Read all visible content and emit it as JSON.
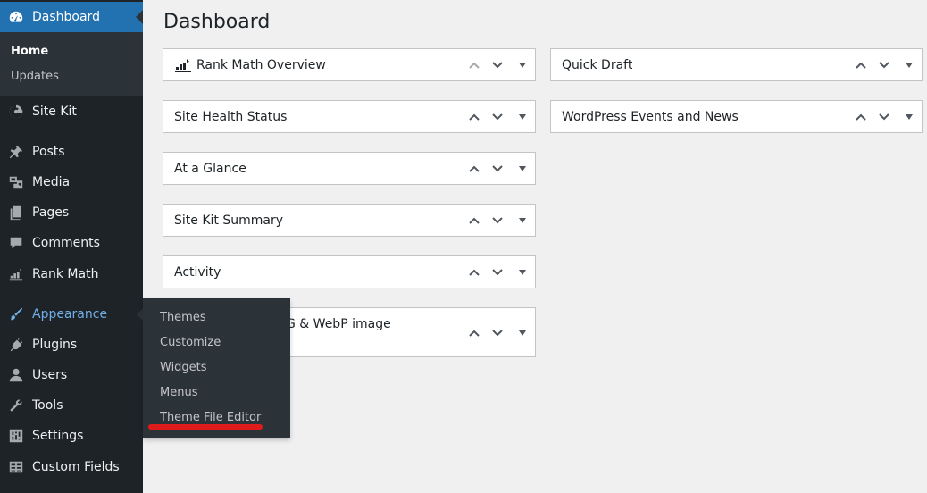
{
  "sidebar": {
    "dashboard": {
      "label": "Dashboard",
      "icon": "gauge-icon"
    },
    "dashboard_sub": {
      "home": "Home",
      "updates": "Updates"
    },
    "items": [
      {
        "label": "Site Kit",
        "icon": "google-g-icon"
      },
      {
        "label": "Posts",
        "icon": "pushpin-icon"
      },
      {
        "label": "Media",
        "icon": "media-icon"
      },
      {
        "label": "Pages",
        "icon": "pages-icon"
      },
      {
        "label": "Comments",
        "icon": "comment-icon"
      },
      {
        "label": "Rank Math",
        "icon": "rank-math-icon"
      },
      {
        "label": "Appearance",
        "icon": "paintbrush-icon"
      },
      {
        "label": "Plugins",
        "icon": "plugin-icon"
      },
      {
        "label": "Users",
        "icon": "user-icon"
      },
      {
        "label": "Tools",
        "icon": "wrench-icon"
      },
      {
        "label": "Settings",
        "icon": "settings-icon"
      },
      {
        "label": "Custom Fields",
        "icon": "table-icon"
      }
    ]
  },
  "flyout": {
    "items": [
      "Themes",
      "Customize",
      "Widgets",
      "Menus",
      "Theme File Editor"
    ]
  },
  "main": {
    "title": "Dashboard",
    "left_widgets": [
      "Rank Math Overview",
      "Site Health Status",
      "At a Glance",
      "Site Kit Summary",
      "Activity",
      "G & WebP image"
    ],
    "right_widgets": [
      "Quick Draft",
      "WordPress Events and News"
    ]
  },
  "colors": {
    "sidebar_bg": "#1d2327",
    "current_bg": "#2271b1",
    "hover_text": "#72aee6",
    "annotation": "#e01b1b"
  }
}
